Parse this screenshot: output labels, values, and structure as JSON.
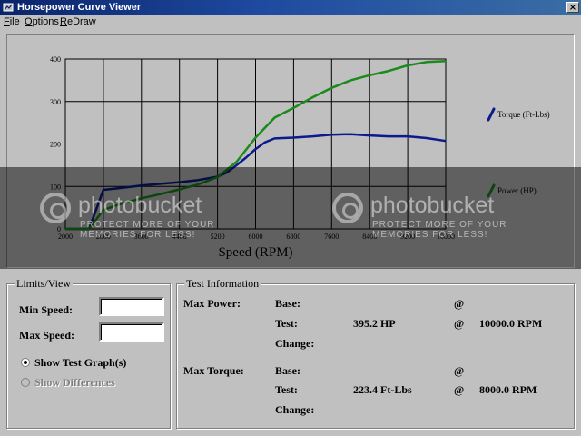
{
  "window": {
    "title": "Horsepower Curve Viewer",
    "close_glyph": "×"
  },
  "menu": [
    "File",
    "Options",
    "ReDraw"
  ],
  "chart_data": {
    "type": "line",
    "title": "",
    "xlabel": "Speed (RPM)",
    "ylabel": "",
    "xlim": [
      2000,
      10000
    ],
    "ylim": [
      0,
      400
    ],
    "x_ticks": [
      "2000",
      "2800",
      "3600",
      "4400",
      "5200",
      "6000",
      "6800",
      "7600",
      "8400",
      "9200",
      "10000"
    ],
    "y_ticks": [
      "0",
      "100",
      "200",
      "300",
      "400"
    ],
    "grid": true,
    "legend_placement": "right",
    "series": [
      {
        "name": "Torque (Ft-Lbs)",
        "color": "#0b1a8c",
        "x": [
          2000,
          2500,
          2800,
          3200,
          3600,
          4000,
          4400,
          4800,
          5200,
          5400,
          5600,
          5800,
          6000,
          6200,
          6400,
          6800,
          7200,
          7600,
          8000,
          8400,
          8800,
          9200,
          9600,
          10000
        ],
        "y": [
          0,
          0,
          92,
          97,
          102,
          106,
          110,
          115,
          123,
          133,
          150,
          168,
          188,
          204,
          213,
          215,
          218,
          222,
          223,
          220,
          218,
          218,
          214,
          207
        ]
      },
      {
        "name": "Power (HP)",
        "color": "#1b8a1b",
        "x": [
          2000,
          2500,
          2800,
          3200,
          3600,
          4000,
          4400,
          4800,
          5200,
          5600,
          6000,
          6400,
          6800,
          7200,
          7600,
          8000,
          8400,
          8800,
          9200,
          9600,
          10000
        ],
        "y": [
          0,
          0,
          45,
          60,
          72,
          82,
          93,
          105,
          122,
          158,
          215,
          262,
          285,
          310,
          332,
          350,
          362,
          372,
          385,
          393,
          395
        ]
      }
    ]
  },
  "watermark": {
    "brand": "photobucket",
    "tagline": "PROTECT MORE OF YOUR MEMORIES FOR LESS!"
  },
  "limits": {
    "title": "Limits/View",
    "min_label": "Min Speed:",
    "max_label": "Max Speed:",
    "min_value": "",
    "max_value": "",
    "show_test_label": "Show Test Graph(s)",
    "show_diff_label": "Show Differences"
  },
  "test_info": {
    "title": "Test Information",
    "max_power_label": "Max Power:",
    "max_torque_label": "Max Torque:",
    "base_label": "Base:",
    "test_label": "Test:",
    "change_label": "Change:",
    "at": "@",
    "power_test_value": "395.2  HP",
    "power_test_speed": "10000.0  RPM",
    "torque_test_value": "223.4  Ft-Lbs",
    "torque_test_speed": "8000.0  RPM"
  }
}
